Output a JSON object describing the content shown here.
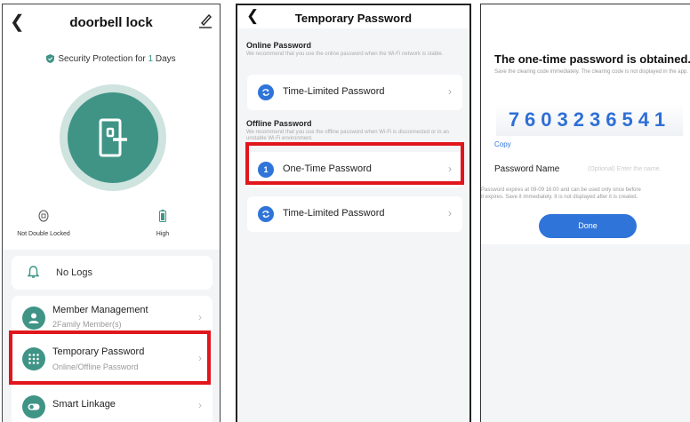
{
  "screen1": {
    "title": "doorbell lock",
    "security": {
      "prefix": "Security Protection for ",
      "days": "1",
      "suffix": " Days"
    },
    "status_lock": "Not Double Locked",
    "status_battery": "High",
    "logs_label": "No Logs",
    "menu": [
      {
        "title": "Member Management",
        "subtitle": "2Family Member(s)"
      },
      {
        "title": "Temporary Password",
        "subtitle": "Online/Offline Password"
      },
      {
        "title": "Smart Linkage"
      }
    ]
  },
  "screen2": {
    "title": "Temporary Password",
    "online": {
      "heading": "Online Password",
      "description": "We recommend that you use the online password when the Wi-Fi network is stable.",
      "items": [
        {
          "label": "Time-Limited Password"
        }
      ]
    },
    "offline": {
      "heading": "Offline Password",
      "description": "We recommend that you use the offline password when Wi-Fi is disconnected or in an unstable Wi-Fi environment.",
      "items": [
        {
          "label": "One-Time Password",
          "badge": "1"
        },
        {
          "label": "Time-Limited Password"
        }
      ]
    }
  },
  "screen3": {
    "title": "The one-time password is obtained.",
    "subtitle": "Save the clearing code immediately. The clearing code is not displayed in the app.",
    "code": "7603236541",
    "copy": "Copy",
    "name_label": "Password Name",
    "name_placeholder": "(Optional) Enter the name.",
    "note_line1": "Password expires at 09-09 16:00 and can be used only once before",
    "note_line2": "it expires. Save it immediately. It is not displayed after it is created.",
    "done": "Done"
  },
  "icons": {
    "back": "chevron-left-icon",
    "edit": "pencil-icon",
    "shield": "shield-icon",
    "lock_door": "door-lock-icon",
    "double_lock": "double-lock-icon",
    "battery": "battery-icon",
    "bell": "bell-icon",
    "member": "person-icon",
    "keypad": "keypad-icon",
    "linkage": "toggle-icon",
    "refresh": "refresh-icon",
    "chevron": "chevron-right-icon"
  },
  "colors": {
    "teal": "#3f9486",
    "blue": "#2f74d9",
    "highlight": "#e0161c"
  }
}
